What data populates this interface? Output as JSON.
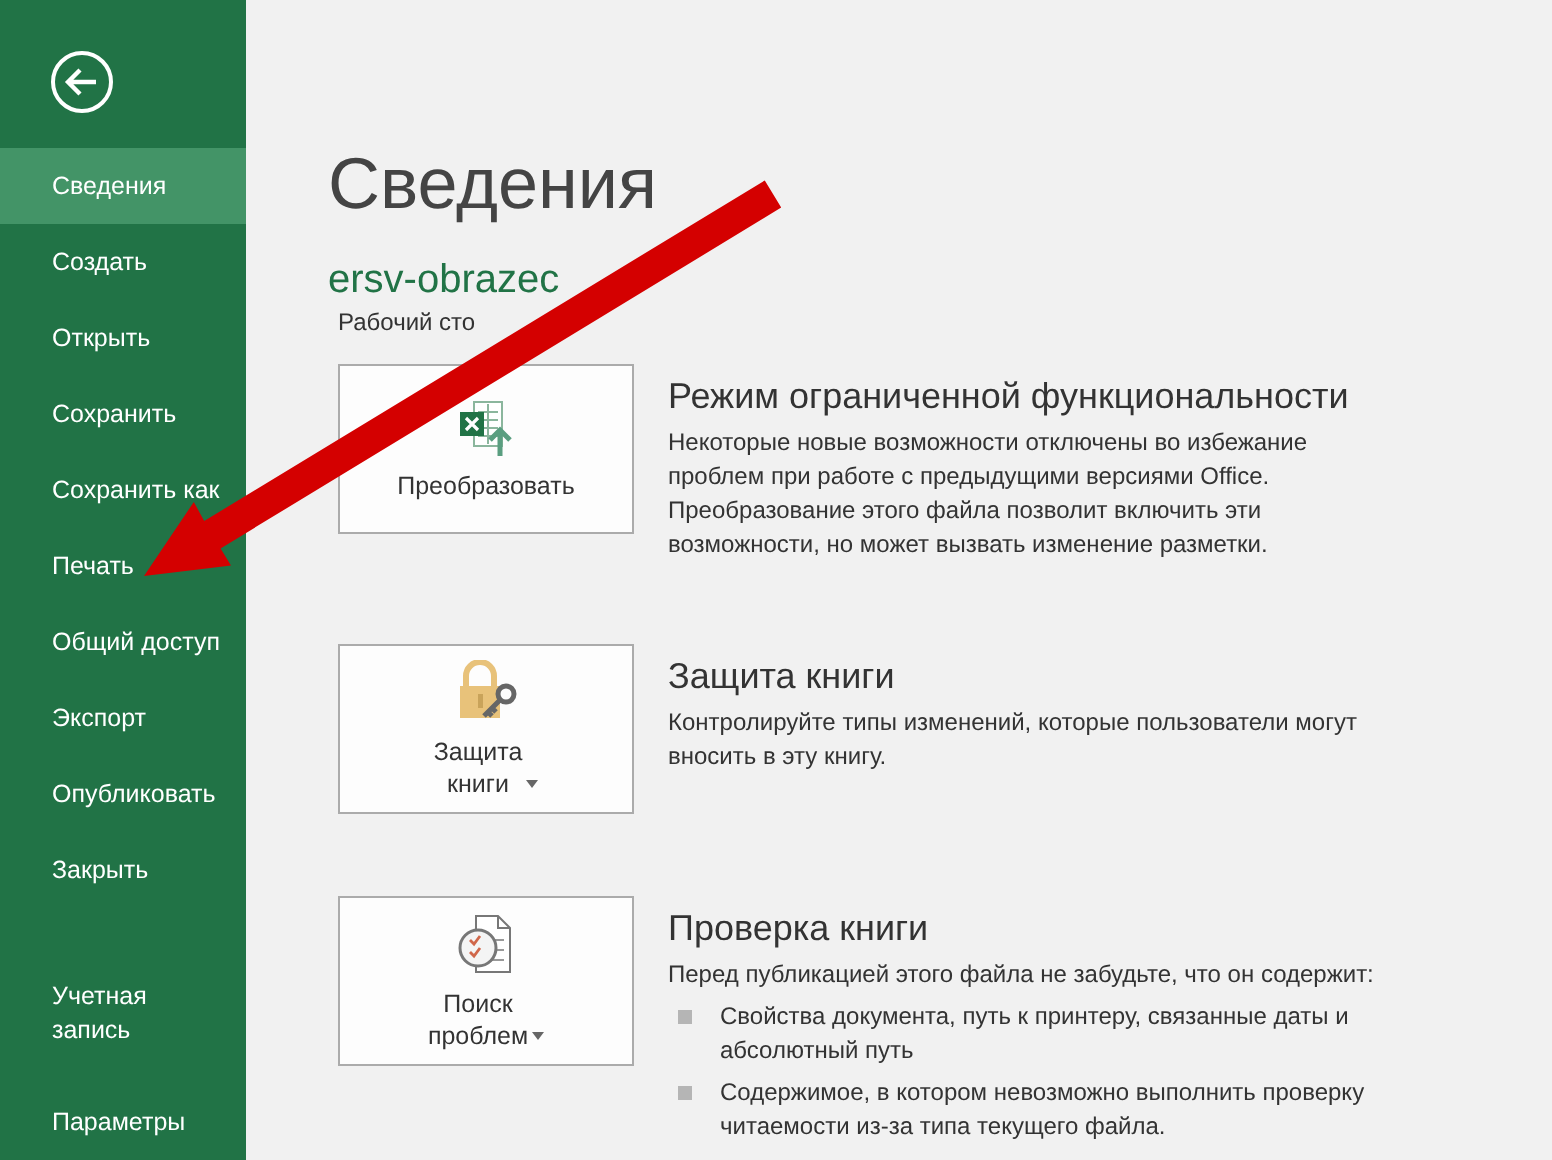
{
  "sidebar": {
    "items": [
      {
        "label": "Сведения",
        "selected": true
      },
      {
        "label": "Создать",
        "selected": false
      },
      {
        "label": "Открыть",
        "selected": false
      },
      {
        "label": "Сохранить",
        "selected": false
      },
      {
        "label": "Сохранить как",
        "selected": false
      },
      {
        "label": "Печать",
        "selected": false
      },
      {
        "label": "Общий доступ",
        "selected": false
      },
      {
        "label": "Экспорт",
        "selected": false
      },
      {
        "label": "Опубликовать",
        "selected": false
      },
      {
        "label": "Закрыть",
        "selected": false
      }
    ],
    "bottom_items": [
      {
        "label": "Учетная запись",
        "selected": false
      },
      {
        "label": "Параметры",
        "selected": false
      }
    ]
  },
  "title": "Сведения",
  "file_name": "ersv-obrazec",
  "file_location": "Рабочий сто",
  "sections": [
    {
      "kind": "convert",
      "button_label": "Преобразовать",
      "dropdown": false,
      "heading": "Режим ограниченной функциональности",
      "description": "Некоторые новые возможности отключены во избежание проблем при работе с предыдущими версиями Office. Преобразование этого файла позволит включить эти возможности, но может вызвать изменение разметки."
    },
    {
      "kind": "protect",
      "button_label": "Защита книги",
      "dropdown": true,
      "heading": "Защита книги",
      "description": "Контролируйте типы изменений, которые пользователи могут вносить в эту книгу."
    },
    {
      "kind": "inspect",
      "button_label": "Поиск проблем",
      "dropdown": true,
      "heading": "Проверка книги",
      "description": "Перед публикацией этого файла не забудьте, что он содержит:",
      "bullets": [
        "Свойства документа, путь к принтеру, связанные даты и абсолютный путь",
        "Содержимое, в котором невозможно выполнить проверку читаемости из-за типа текущего файла."
      ]
    }
  ]
}
